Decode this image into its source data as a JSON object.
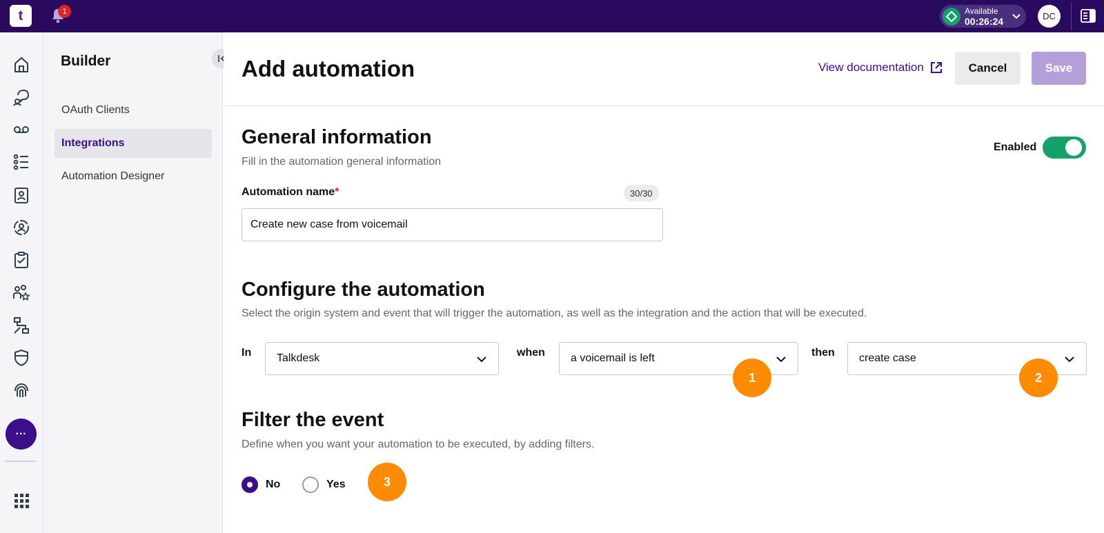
{
  "topbar": {
    "logo_text": "t",
    "notification_count": "1",
    "status_label": "Available",
    "status_time": "00:26:24",
    "avatar_initials": "DC"
  },
  "rail": {
    "icons": [
      "home-icon",
      "conversations-icon",
      "voicemail-icon",
      "list-icon",
      "contacts-icon",
      "agent-icon",
      "tasks-icon",
      "teams-icon",
      "workflow-icon",
      "shield-icon",
      "fingerprint-icon"
    ],
    "more_label": "···"
  },
  "builder": {
    "title": "Builder",
    "items": [
      {
        "label": "OAuth Clients",
        "active": false
      },
      {
        "label": "Integrations",
        "active": true
      },
      {
        "label": "Automation Designer",
        "active": false
      }
    ]
  },
  "header": {
    "title": "Add automation",
    "doc_link": "View documentation",
    "cancel_label": "Cancel",
    "save_label": "Save"
  },
  "general": {
    "title": "General information",
    "subtitle": "Fill in the automation general information",
    "enabled_label": "Enabled",
    "enabled": true,
    "name_label": "Automation name",
    "required_mark": "*",
    "counter": "30/30",
    "name_value": "Create new case from voicemail"
  },
  "configure": {
    "title": "Configure the automation",
    "subtitle": "Select the origin system and event that will trigger the automation, as well as the integration and the action that will be executed.",
    "in_label": "In",
    "in_value": "Talkdesk",
    "when_label": "when",
    "when_value": "a voicemail is left",
    "then_label": "then",
    "then_value": "create case"
  },
  "filter": {
    "title": "Filter the event",
    "subtitle": "Define when you want your automation to be executed, by adding filters.",
    "option_no": "No",
    "option_yes": "Yes",
    "selected": "No"
  },
  "steps": [
    "1",
    "2",
    "3"
  ],
  "colors": {
    "topbar": "#2a0a5e",
    "accent": "#3b0f8a",
    "toggle_on": "#16a06a",
    "step_marker": "#ff8c00"
  }
}
